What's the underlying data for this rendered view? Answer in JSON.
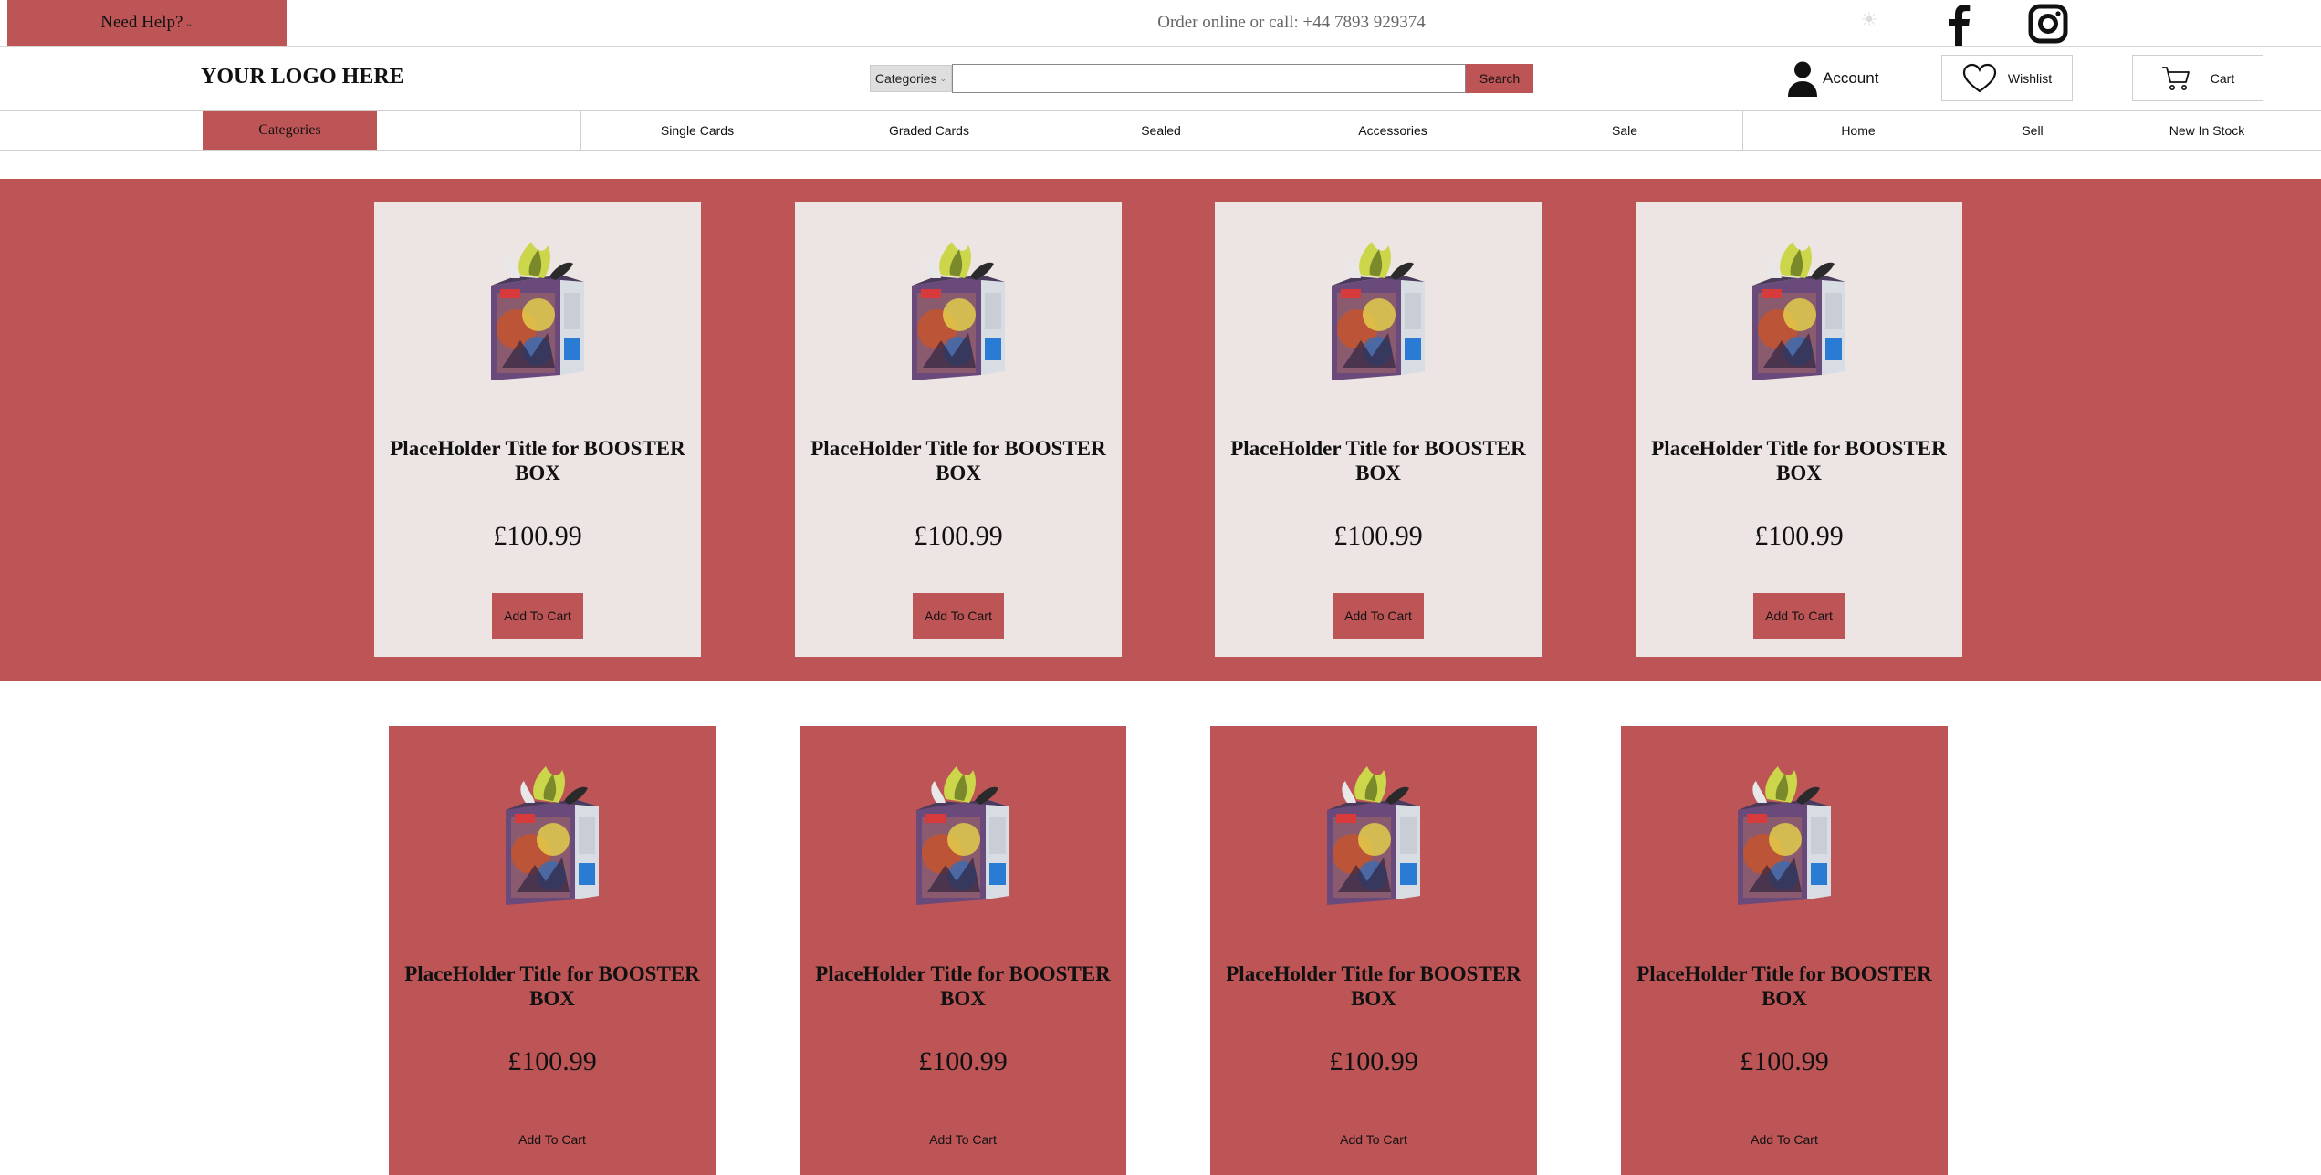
{
  "topbar": {
    "help_label": "Need Help?",
    "help_chevron": "⌄",
    "order_text": "Order online or call: +44 7893 929374",
    "icons": [
      "sun-icon",
      "facebook-icon",
      "instagram-icon"
    ]
  },
  "header": {
    "logo": "YOUR LOGO HERE",
    "search": {
      "category_label": "Categories",
      "input_value": "",
      "placeholder": "",
      "button_label": "Search"
    },
    "account_label": "Account",
    "wishlist_label": "Wishlist",
    "cart_label": "Cart"
  },
  "nav": {
    "categories_label": "Categories",
    "links": [
      "Single Cards",
      "Graded Cards",
      "Sealed",
      "Accessories",
      "Sale"
    ],
    "right_links": [
      "Home",
      "Sell",
      "New In Stock"
    ]
  },
  "featured_products": [
    {
      "title": "PlaceHolder Title for BOOSTER BOX",
      "price": "£100.99",
      "button": "Add To Cart"
    },
    {
      "title": "PlaceHolder Title for BOOSTER BOX",
      "price": "£100.99",
      "button": "Add To Cart"
    },
    {
      "title": "PlaceHolder Title for BOOSTER BOX",
      "price": "£100.99",
      "button": "Add To Cart"
    },
    {
      "title": "PlaceHolder Title for BOOSTER BOX",
      "price": "£100.99",
      "button": "Add To Cart"
    }
  ],
  "products": [
    {
      "title": "PlaceHolder Title for BOOSTER BOX",
      "price": "£100.99",
      "button": "Add To Cart"
    },
    {
      "title": "PlaceHolder Title for BOOSTER BOX",
      "price": "£100.99",
      "button": "Add To Cart"
    },
    {
      "title": "PlaceHolder Title for BOOSTER BOX",
      "price": "£100.99",
      "button": "Add To Cart"
    },
    {
      "title": "PlaceHolder Title for BOOSTER BOX",
      "price": "£100.99",
      "button": "Add To Cart"
    }
  ],
  "colors": {
    "accent": "#bd5557",
    "card_background": "#ede4e4",
    "page_background": "#ffffff"
  }
}
